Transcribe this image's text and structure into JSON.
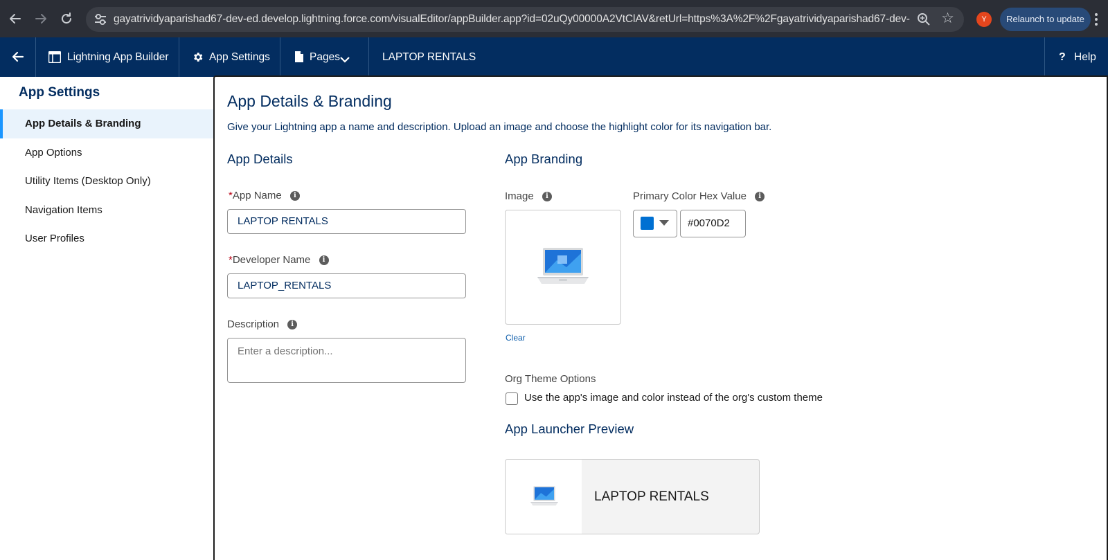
{
  "browser": {
    "url": "gayatrividyaparishad67-dev-ed.develop.lightning.force.com/visualEditor/appBuilder.app?id=02uQy00000A2VtClAV&retUrl=https%3A%2F%2Fgayatrividyaparishad67-dev-ed.dev...",
    "profile_initial": "Y",
    "relaunch_label": "Relaunch to update",
    "icons": [
      "back-icon",
      "forward-icon",
      "reload-icon",
      "site-settings-icon",
      "zoom-icon",
      "bookmark-star-icon",
      "more-menu-icon"
    ]
  },
  "header": {
    "back_icon": "arrow-left-icon",
    "builder_label": "Lightning App Builder",
    "settings_label": "App Settings",
    "pages_label": "Pages",
    "app_name": "LAPTOP RENTALS",
    "help_label": "Help",
    "help_glyph": "?"
  },
  "sidebar": {
    "heading": "App Settings",
    "items": [
      {
        "label": "App Details & Branding",
        "active": true
      },
      {
        "label": "App Options",
        "active": false
      },
      {
        "label": "Utility Items (Desktop Only)",
        "active": false
      },
      {
        "label": "Navigation Items",
        "active": false
      },
      {
        "label": "User Profiles",
        "active": false
      }
    ]
  },
  "main": {
    "title": "App Details & Branding",
    "subtitle": "Give your Lightning app a name and description. Upload an image and choose the highlight color for its navigation bar.",
    "details": {
      "heading": "App Details",
      "app_name_label": "App Name",
      "app_name_value": "LAPTOP RENTALS",
      "developer_name_label": "Developer Name",
      "developer_name_value": "LAPTOP_RENTALS",
      "description_label": "Description",
      "description_placeholder": "Enter a description...",
      "required_mark": "*",
      "info_glyph": "i"
    },
    "branding": {
      "heading": "App Branding",
      "image_label": "Image",
      "clear_label": "Clear",
      "color_label": "Primary Color Hex Value",
      "color_value": "#0070D2",
      "swatch_color": "#0070d2",
      "theme_label": "Org Theme Options",
      "theme_checkbox_label": "Use the app's image and color instead of the org's custom theme",
      "theme_checked": false
    },
    "preview": {
      "heading": "App Launcher Preview",
      "app_name": "LAPTOP RENTALS"
    }
  },
  "colors": {
    "header_bg": "#032d60",
    "chrome_bg": "#2b2e36",
    "accent": "#1b96ff",
    "heading_text": "#032d60"
  }
}
